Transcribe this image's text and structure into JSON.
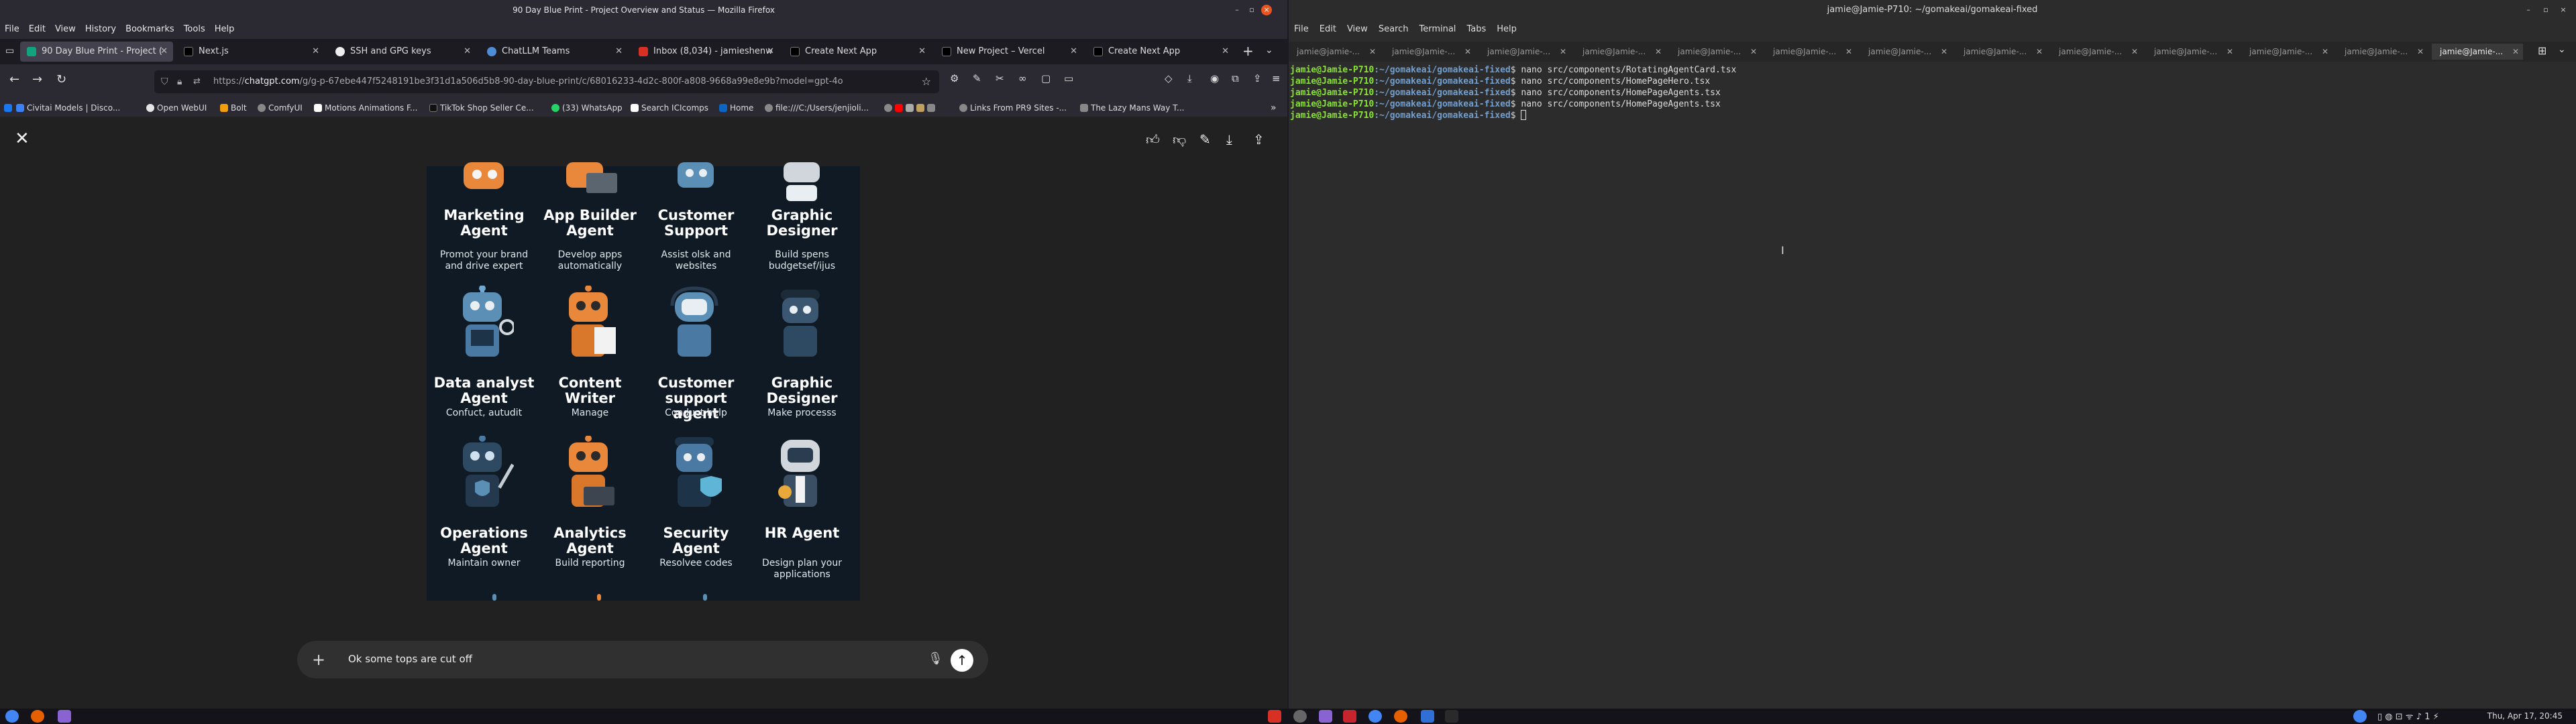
{
  "firefox": {
    "window_title": "90 Day Blue Print - Project Overview and Status — Mozilla Firefox",
    "menu": [
      "File",
      "Edit",
      "View",
      "History",
      "Bookmarks",
      "Tools",
      "Help"
    ],
    "tabs": [
      {
        "label": "90 Day Blue Print - Project (",
        "active": true
      },
      {
        "label": "Next.js",
        "active": false
      },
      {
        "label": "SSH and GPG keys",
        "active": false
      },
      {
        "label": "ChatLLM Teams",
        "active": false
      },
      {
        "label": "Inbox (8,034) - jamieshenw",
        "active": false
      },
      {
        "label": "Create Next App",
        "active": false
      },
      {
        "label": "New Project – Vercel",
        "active": false
      },
      {
        "label": "Create Next App",
        "active": false
      }
    ],
    "url_prefix": "https://",
    "url_host": "chatgpt.com",
    "url_path": "/g/g-p-67ebe447f5248191be3f31d1a506d5b8-90-day-blue-print/c/68016233-4d2c-800f-a808-9668a99e8e9b?model=gpt-4o",
    "bookmarks": [
      {
        "label": "Civitai Models | Disco...",
        "color": "#3b82f6"
      },
      {
        "label": "Open WebUI",
        "color": "#e5e5e5"
      },
      {
        "label": "Bolt",
        "color": "#f59e0b"
      },
      {
        "label": "ComfyUI",
        "color": "#888888"
      },
      {
        "label": "Motions Animations F...",
        "color": "#ffffff"
      },
      {
        "label": "TikTok Shop Seller Ce...",
        "color": "#111111"
      },
      {
        "label": "(33) WhatsApp",
        "color": "#25d366"
      },
      {
        "label": "Search ICIcomps",
        "color": "#ffffff"
      },
      {
        "label": "Home",
        "color": "#0a66c2"
      },
      {
        "label": "file:///C:/Users/jenjioli...",
        "color": "#888888"
      },
      {
        "label": "Links From PR9 Sites -...",
        "color": "#888888"
      },
      {
        "label": "The Lazy Mans Way T...",
        "color": "#888888"
      }
    ]
  },
  "chat": {
    "composer_text": "Ok some tops are cut off",
    "agents": [
      {
        "name": "Marketing Agent",
        "desc": "Promot your brand and drive expert",
        "color": "#e9873a"
      },
      {
        "name": "App Builder Agent",
        "desc": "Develop apps automatically",
        "color": "#e9873a"
      },
      {
        "name": "Customer Support",
        "desc": "Assist olsk and websites",
        "color": "#5b8fb5"
      },
      {
        "name": "Graphic Designer",
        "desc": "Build spens budgetsef/ijus",
        "color": "#d0d6dc"
      },
      {
        "name": "Data analyst Agent",
        "desc": "Confuct, autudit",
        "color": "#5b8fb5"
      },
      {
        "name": "Content Writer",
        "desc": "Manage",
        "color": "#e9873a"
      },
      {
        "name": "Customer support agent",
        "desc": "Conduct help",
        "color": "#5b8fb5"
      },
      {
        "name": "Graphic Designer",
        "desc": "Make processs",
        "color": "#3b5670"
      },
      {
        "name": "Operations Agent",
        "desc": "Maintain owner",
        "color": "#2e4a63"
      },
      {
        "name": "Analytics Agent",
        "desc": "Build reporting",
        "color": "#e9873a"
      },
      {
        "name": "Security Agent",
        "desc": "Resolveе codes",
        "color": "#4a7aa3"
      },
      {
        "name": "HR Agent",
        "desc": "Design plan your applications",
        "color": "#d0d6dc"
      }
    ]
  },
  "terminal": {
    "window_title": "jamie@Jamie-P710: ~/gomakeai/gomakeai-fixed",
    "menu": [
      "File",
      "Edit",
      "View",
      "Search",
      "Terminal",
      "Tabs",
      "Help"
    ],
    "tabs": [
      "jamie@jamie-...",
      "jamie@Jamie-...",
      "jamie@Jamie-...",
      "jamie@Jamie-...",
      "jamie@Jamie-...",
      "jamie@Jamie-...",
      "jamie@Jamie-...",
      "jamie@Jamie-...",
      "jamie@Jamie-...",
      "jamie@Jamie-...",
      "jamie@Jamie-...",
      "jamie@Jamie-...",
      "jamie@Jamie-..."
    ],
    "prompt_user": "jamie@Jamie-P710",
    "prompt_path": ":~/gomakeai/gomakeai-fixed",
    "lines": [
      "nano src/components/RotatingAgentCard.tsx",
      "nano src/components/HomePageHero.tsx",
      "nano src/components/HomePageAgents.tsx",
      "nano src/components/HomePageAgents.tsx",
      ""
    ]
  },
  "taskbar": {
    "clock": "Thu, Apr 17, 20:45"
  }
}
